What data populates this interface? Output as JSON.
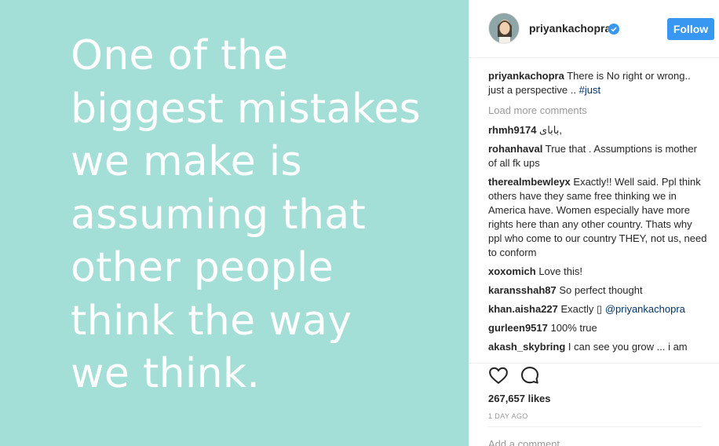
{
  "post": {
    "quote_lines": [
      "One of the",
      "biggest mistakes",
      "we make is",
      "assuming that",
      "other people",
      "think the way",
      "we think."
    ],
    "background_color": "#a3dfd6"
  },
  "header": {
    "username": "priyankachopra",
    "verified_icon": "verified-badge-icon",
    "follow_label": "Follow"
  },
  "caption": {
    "username": "priyankachopra",
    "text": "There is No right or wrong.. just a perspective ..",
    "hashtag": "#just"
  },
  "load_more_label": "Load more comments",
  "comments": [
    {
      "user": "rhmh9174",
      "text": "بابای,"
    },
    {
      "user": "rohanhaval",
      "text": "True that . Assumptions is mother of all fk ups"
    },
    {
      "user": "therealmbewleyx",
      "text": "Exactly!! Well said. Ppl think others have they same free thinking we in America have. Women especially have more rights here than any other country. Thats why ppl who come to our country THEY, not us, need to conform"
    },
    {
      "user": "xoxomich",
      "text": "Love this!"
    },
    {
      "user": "karansshah87",
      "text": "So perfect thought"
    },
    {
      "user": "khan.aisha227",
      "text": "Exactly ▯",
      "mention": "@priyankachopra"
    },
    {
      "user": "gurleen9517",
      "text": "100% true"
    },
    {
      "user": "akash_skybring",
      "text": "I can see you grow ... i am"
    }
  ],
  "actions": {
    "like_icon": "heart-icon",
    "comment_icon": "comment-icon",
    "likes": "267,657 likes",
    "time": "1 DAY AGO",
    "add_comment_placeholder": "Add a comment..."
  },
  "colors": {
    "accent": "#3897f0",
    "link": "#003569",
    "muted": "#999999"
  }
}
